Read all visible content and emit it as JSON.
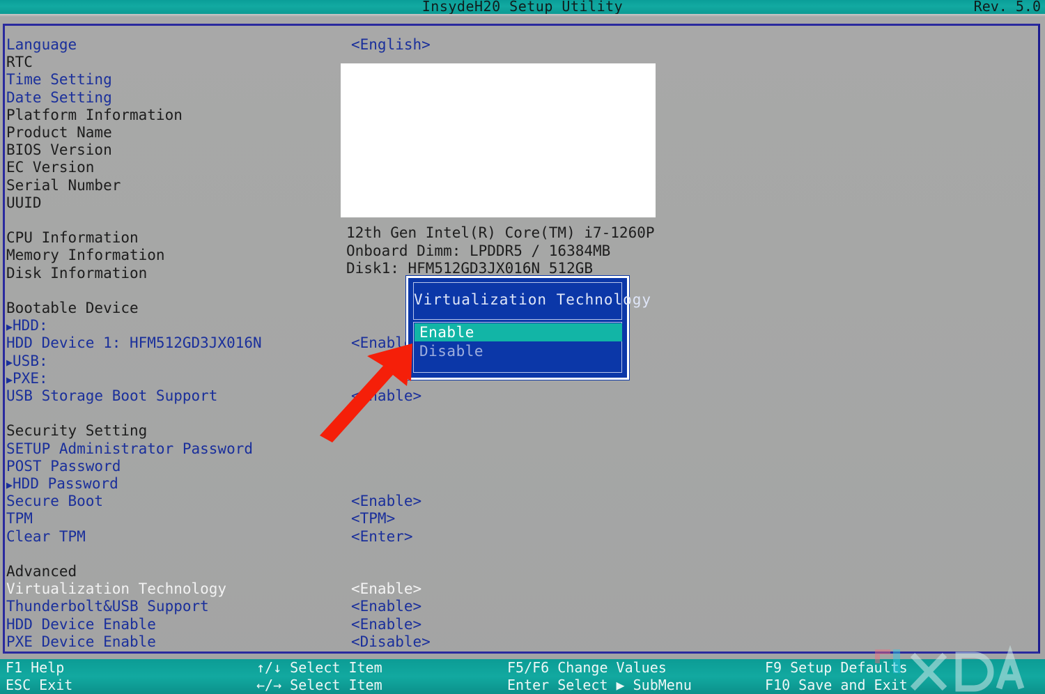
{
  "titlebar": {
    "title": "InsydeH20 Setup Utility",
    "revision": "Rev. 5.0"
  },
  "menu": {
    "items": [
      {
        "label": "Language",
        "color": "blue",
        "submenu": false,
        "value": "<English>",
        "value_color": "blue"
      },
      {
        "label": "RTC",
        "color": "dark",
        "submenu": false,
        "value": ""
      },
      {
        "label": "Time Setting",
        "color": "blue",
        "submenu": false,
        "value": ""
      },
      {
        "label": "Date Setting",
        "color": "blue",
        "submenu": false,
        "value": ""
      },
      {
        "label": "Platform Information",
        "color": "dark",
        "submenu": false,
        "value": ""
      },
      {
        "label": "Product Name",
        "color": "dark",
        "submenu": false,
        "value": ""
      },
      {
        "label": "BIOS Version",
        "color": "dark",
        "submenu": false,
        "value": ""
      },
      {
        "label": "EC Version",
        "color": "dark",
        "submenu": false,
        "value": ""
      },
      {
        "label": "Serial Number",
        "color": "dark",
        "submenu": false,
        "value": ""
      },
      {
        "label": "UUID",
        "color": "dark",
        "submenu": false,
        "value": ""
      },
      {
        "label": "",
        "color": "dark",
        "submenu": false,
        "value": ""
      },
      {
        "label": "CPU Information",
        "color": "dark",
        "submenu": false,
        "value": ""
      },
      {
        "label": "Memory Information",
        "color": "dark",
        "submenu": false,
        "value": ""
      },
      {
        "label": "Disk Information",
        "color": "dark",
        "submenu": false,
        "value": ""
      },
      {
        "label": "",
        "color": "dark",
        "submenu": false,
        "value": ""
      },
      {
        "label": "Bootable Device",
        "color": "dark",
        "submenu": false,
        "value": ""
      },
      {
        "label": "HDD:",
        "color": "blue",
        "submenu": true,
        "value": ""
      },
      {
        "label": "HDD Device 1: HFM512GD3JX016N",
        "color": "blue",
        "submenu": false,
        "value": "<Enable>",
        "value_color": "blue"
      },
      {
        "label": "USB:",
        "color": "blue",
        "submenu": true,
        "value": ""
      },
      {
        "label": "PXE:",
        "color": "blue",
        "submenu": true,
        "value": ""
      },
      {
        "label": "USB Storage Boot Support",
        "color": "blue",
        "submenu": false,
        "value": "<Enable>",
        "value_color": "blue"
      },
      {
        "label": "",
        "color": "dark",
        "submenu": false,
        "value": ""
      },
      {
        "label": "Security Setting",
        "color": "dark",
        "submenu": false,
        "value": ""
      },
      {
        "label": "SETUP Administrator Password",
        "color": "blue",
        "submenu": false,
        "value": ""
      },
      {
        "label": "POST Password",
        "color": "blue",
        "submenu": false,
        "value": ""
      },
      {
        "label": "HDD Password",
        "color": "blue",
        "submenu": true,
        "value": ""
      },
      {
        "label": "Secure Boot",
        "color": "blue",
        "submenu": false,
        "value": "<Enable>",
        "value_color": "blue"
      },
      {
        "label": "TPM",
        "color": "blue",
        "submenu": false,
        "value": "<TPM>",
        "value_color": "blue"
      },
      {
        "label": "Clear TPM",
        "color": "blue",
        "submenu": false,
        "value": "<Enter>",
        "value_color": "blue"
      },
      {
        "label": "",
        "color": "dark",
        "submenu": false,
        "value": ""
      },
      {
        "label": "Advanced",
        "color": "dark",
        "submenu": false,
        "value": ""
      },
      {
        "label": "Virtualization Technology",
        "color": "white",
        "submenu": false,
        "value": "<Enable>",
        "value_color": "white"
      },
      {
        "label": "Thunderbolt&USB Support",
        "color": "blue",
        "submenu": false,
        "value": "<Enable>",
        "value_color": "blue"
      },
      {
        "label": "HDD Device Enable",
        "color": "blue",
        "submenu": false,
        "value": "<Enable>",
        "value_color": "blue"
      },
      {
        "label": "PXE Device Enable",
        "color": "blue",
        "submenu": false,
        "value": "<Disable>",
        "value_color": "blue"
      }
    ]
  },
  "system_info": {
    "lines": [
      "12th Gen Intel(R) Core(TM) i7-1260P",
      "Onboard Dimm: LPDDR5 / 16384MB",
      "Disk1: HFM512GD3JX016N 512GB"
    ]
  },
  "dialog": {
    "title": "Virtualization Technology",
    "options": [
      {
        "label": "Enable",
        "selected": true
      },
      {
        "label": "Disable",
        "selected": false
      }
    ]
  },
  "statusbar": {
    "columns": [
      {
        "lines": [
          "F1  Help",
          "ESC Exit"
        ]
      },
      {
        "lines": [
          "↑/↓ Select Item",
          "←/→ Select Item"
        ]
      },
      {
        "lines": [
          "F5/F6 Change Values",
          "Enter Select ▶ SubMenu"
        ]
      },
      {
        "lines": [
          "F9  Setup Defaults",
          "F10 Save and Exit"
        ]
      }
    ]
  },
  "watermark": {
    "text": "XDA"
  },
  "colors": {
    "header_teal": "#12aaa2",
    "menu_blue": "#1a2f9b",
    "dialog_blue": "#0b37a8",
    "highlight_teal": "#12b5a6",
    "arrow_red": "#f51f09",
    "background_gray": "#a9a9a9"
  }
}
